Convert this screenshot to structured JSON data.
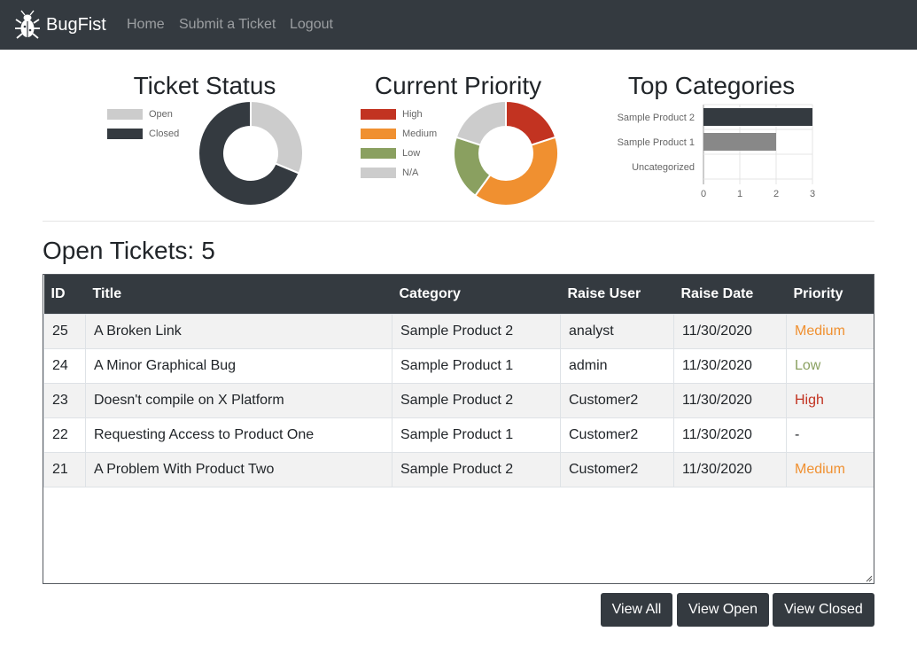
{
  "navbar": {
    "brand": "BugFist",
    "links": [
      "Home",
      "Submit a Ticket",
      "Logout"
    ]
  },
  "charts": {
    "status_title": "Ticket Status",
    "priority_title": "Current Priority",
    "categories_title": "Top Categories"
  },
  "chart_data": [
    {
      "type": "pie",
      "title": "Ticket Status",
      "labels": [
        "Open",
        "Closed"
      ],
      "values": [
        5,
        11
      ],
      "colors": [
        "#cccccc",
        "#343a40"
      ],
      "legend": "left"
    },
    {
      "type": "pie",
      "title": "Current Priority",
      "labels": [
        "High",
        "Medium",
        "Low",
        "N/A"
      ],
      "values": [
        2,
        4,
        2,
        2
      ],
      "colors": [
        "#c23321",
        "#f09030",
        "#8aa060",
        "#cccccc"
      ],
      "legend": "left"
    },
    {
      "type": "bar",
      "orientation": "horizontal",
      "title": "Top Categories",
      "categories": [
        "Sample Product 2",
        "Sample Product 1",
        "Uncategorized"
      ],
      "values": [
        3,
        2,
        0
      ],
      "colors": [
        "#343a40",
        "#888888",
        "#cccccc"
      ],
      "xlim": [
        0,
        3
      ],
      "xticks": [
        "0",
        "1",
        "2",
        "3"
      ],
      "grid": true
    }
  ],
  "tickets": {
    "heading_label": "Open Tickets:",
    "heading_count": "5",
    "columns": [
      "ID",
      "Title",
      "Category",
      "Raise User",
      "Raise Date",
      "Priority"
    ],
    "rows": [
      {
        "id": "25",
        "title": "A Broken Link",
        "category": "Sample Product 2",
        "user": "analyst",
        "date": "11/30/2020",
        "priority": "Medium"
      },
      {
        "id": "24",
        "title": "A Minor Graphical Bug",
        "category": "Sample Product 1",
        "user": "admin",
        "date": "11/30/2020",
        "priority": "Low"
      },
      {
        "id": "23",
        "title": "Doesn't compile on X Platform",
        "category": "Sample Product 2",
        "user": "Customer2",
        "date": "11/30/2020",
        "priority": "High"
      },
      {
        "id": "22",
        "title": "Requesting Access to Product One",
        "category": "Sample Product 1",
        "user": "Customer2",
        "date": "11/30/2020",
        "priority": "-"
      },
      {
        "id": "21",
        "title": "A Problem With Product Two",
        "category": "Sample Product 2",
        "user": "Customer2",
        "date": "11/30/2020",
        "priority": "Medium"
      }
    ]
  },
  "buttons": {
    "view_all": "View All",
    "view_open": "View Open",
    "view_closed": "View Closed"
  },
  "icons": {
    "brand": "bug-icon"
  }
}
